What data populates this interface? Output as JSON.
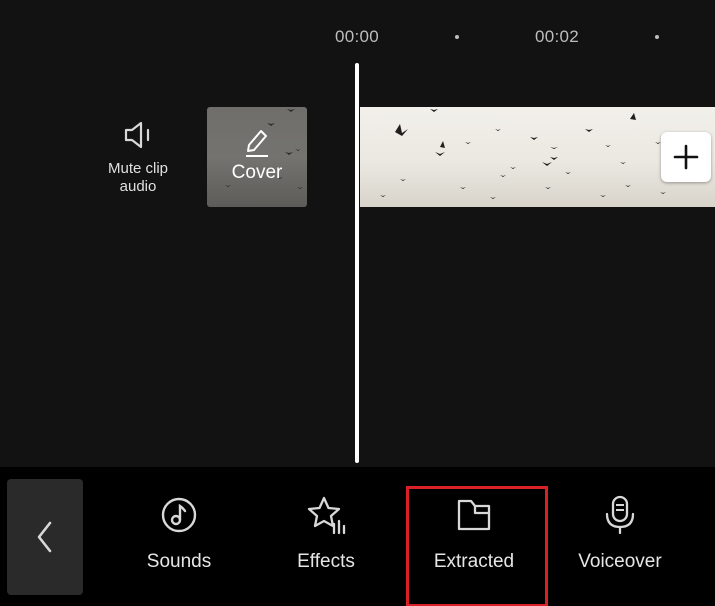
{
  "timeline": {
    "ruler": {
      "marks": [
        "00:00",
        "00:02"
      ]
    },
    "mute_clip_audio": {
      "label": "Mute clip\naudio",
      "icon": "speaker-icon"
    },
    "cover": {
      "label": "Cover",
      "icon": "edit-pencil-icon"
    },
    "add_clip": {
      "icon": "plus-icon"
    }
  },
  "toolbar": {
    "back": {
      "icon": "chevron-left-icon"
    },
    "items": [
      {
        "label": "Sounds",
        "icon": "music-note-icon"
      },
      {
        "label": "Effects",
        "icon": "star-sparkle-icon"
      },
      {
        "label": "Extracted",
        "icon": "folder-icon",
        "highlighted": true
      },
      {
        "label": "Voiceover",
        "icon": "microphone-icon"
      }
    ]
  },
  "colors": {
    "background": "#121212",
    "toolbar_background": "#000000",
    "highlight_border": "#d92027",
    "text": "#e6e6e6"
  }
}
